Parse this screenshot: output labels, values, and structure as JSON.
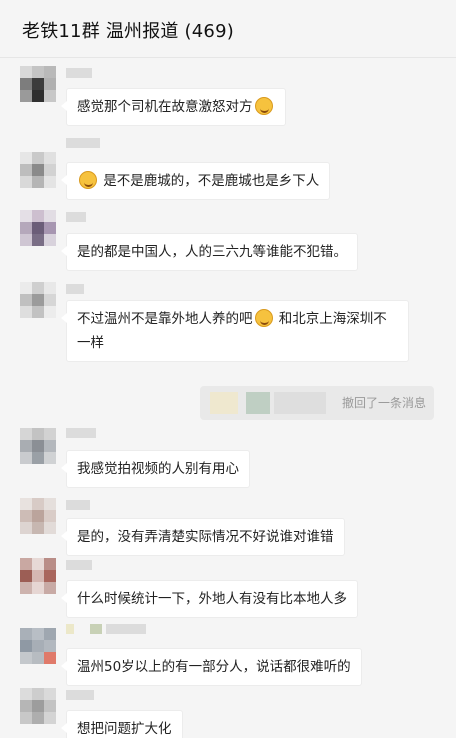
{
  "header": {
    "title": "老铁11群  温州报道 (469)"
  },
  "messages": [
    {
      "text": "感觉那个司机在故意激怒对方",
      "emoji_after": "face-with-tears-emoji"
    },
    {
      "text": "是不是鹿城的，不是鹿城也是乡下人",
      "emoji_before": "face-with-tears-emoji"
    },
    {
      "text": "是的都是中国人，人的三六九等谁能不犯错。"
    },
    {
      "text_part1": "不过温州不是靠外地人养的吧",
      "text_part2": "和北京上海深圳不一样",
      "emoji_mid": "face-with-tears-emoji"
    },
    {
      "text": "我感觉拍视频的人别有用心"
    },
    {
      "text": "是的，没有弄清楚实际情况不好说谁对谁错"
    },
    {
      "text": "什么时候统计一下，外地人有没有比本地人多"
    },
    {
      "text": "温州50岁以上的有一部分人，说话都很难听的"
    },
    {
      "text": "想把问题扩大化"
    }
  ],
  "recall_notice": {
    "text": "撤回了一条消息"
  }
}
